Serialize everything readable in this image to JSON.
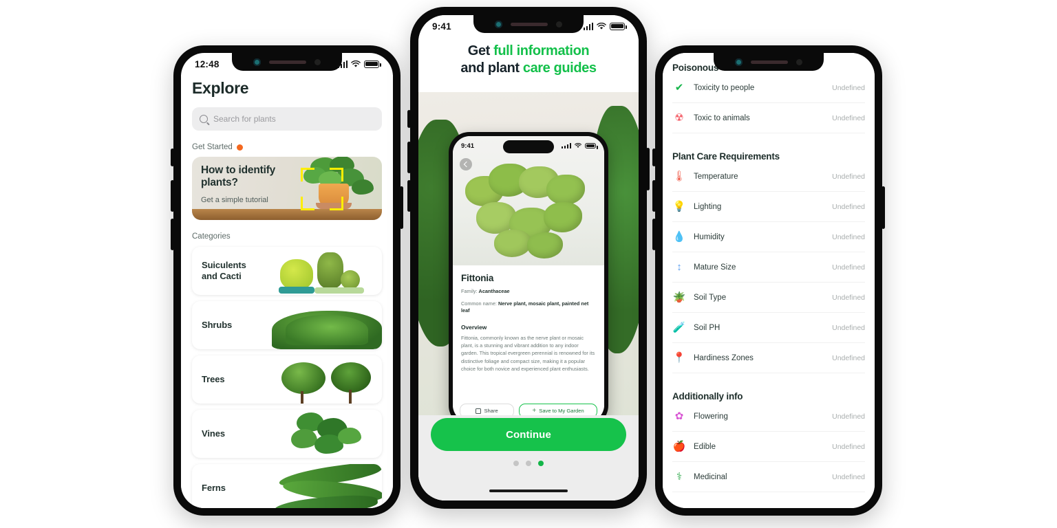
{
  "left_phone": {
    "status": {
      "time": "12:48"
    },
    "title": "Explore",
    "search": {
      "placeholder": "Search for plants",
      "icon": "search-icon"
    },
    "get_started": {
      "label": "Get Started",
      "badge_color": "#f4681f"
    },
    "hero": {
      "title_line1": "How to identify",
      "title_line2": "plants?",
      "subtitle": "Get a simple tutorial"
    },
    "categories_label": "Categories",
    "categories": [
      {
        "name": "Suiculents\nand Cacti"
      },
      {
        "name": "Shrubs"
      },
      {
        "name": "Trees"
      },
      {
        "name": "Vines"
      },
      {
        "name": "Ferns"
      }
    ]
  },
  "center_phone": {
    "status": {
      "time": "9:41"
    },
    "headline": {
      "part1": "Get ",
      "accent1": "full information",
      "part2": "and plant ",
      "accent2": "care guides",
      "accent_color": "#13c04a"
    },
    "inner": {
      "status": {
        "time": "9:41"
      },
      "back_icon": "back-chevron-icon",
      "plant_name": "Fittonia",
      "family_label": "Family:",
      "family_value": "Acanthaceae",
      "common_label": "Common name:",
      "common_value": "Nerve plant, mosaic plant, painted net leaf",
      "overview_label": "Overview",
      "overview_text": "Fittonia, commonly known as the nerve plant or mosaic plant, is a stunning and vibrant addition to any indoor garden. This tropical evergreen perennial is renowned for its distinctive foliage and compact size, making it a popular choice for both novice and experienced plant enthusiasts.",
      "share_label": "Share",
      "save_label": "Save to My Garden"
    },
    "continue_label": "Continue",
    "page_dots": {
      "count": 3,
      "active_index": 2,
      "active_color": "#13b548"
    }
  },
  "right_phone": {
    "sections": [
      {
        "heading": "Poisonous",
        "rows": [
          {
            "icon": "check-circle-icon",
            "glyph": "✔",
            "color": "#15b54a",
            "label": "Toxicity to people",
            "value": "Undefined"
          },
          {
            "icon": "hazard-icon",
            "glyph": "☢",
            "color": "#f4606a",
            "label": "Toxic to animals",
            "value": "Undefined"
          }
        ]
      },
      {
        "heading": "Plant Care Requirements",
        "rows": [
          {
            "icon": "thermometer-icon",
            "glyph": "🌡",
            "color": "#f05b4a",
            "label": "Temperature",
            "value": "Undefined"
          },
          {
            "icon": "lightbulb-icon",
            "glyph": "💡",
            "color": "#f5c518",
            "label": "Lighting",
            "value": "Undefined"
          },
          {
            "icon": "water-drop-icon",
            "glyph": "💧",
            "color": "#2f7ff0",
            "label": "Humidity",
            "value": "Undefined"
          },
          {
            "icon": "mature-size-icon",
            "glyph": "↕",
            "color": "#5b9ef0",
            "label": "Mature Size",
            "value": "Undefined"
          },
          {
            "icon": "soil-pot-icon",
            "glyph": "🪴",
            "color": "#c88a4e",
            "label": "Soil Type",
            "value": "Undefined"
          },
          {
            "icon": "soil-ph-icon",
            "glyph": "🧪",
            "color": "#e0a33c",
            "label": "Soil PH",
            "value": "Undefined"
          },
          {
            "icon": "hardiness-zone-icon",
            "glyph": "📍",
            "color": "#3f77d6",
            "label": "Hardiness Zones",
            "value": "Undefined"
          }
        ]
      },
      {
        "heading": "Additionally info",
        "rows": [
          {
            "icon": "flower-icon",
            "glyph": "✿",
            "color": "#d957d4",
            "label": "Flowering",
            "value": "Undefined"
          },
          {
            "icon": "apple-icon",
            "glyph": "🍎",
            "color": "#f4543c",
            "label": "Edible",
            "value": "Undefined"
          },
          {
            "icon": "medical-shield-icon",
            "glyph": "⚕",
            "color": "#2ea84a",
            "label": "Medicinal",
            "value": "Undefined"
          }
        ]
      }
    ]
  }
}
